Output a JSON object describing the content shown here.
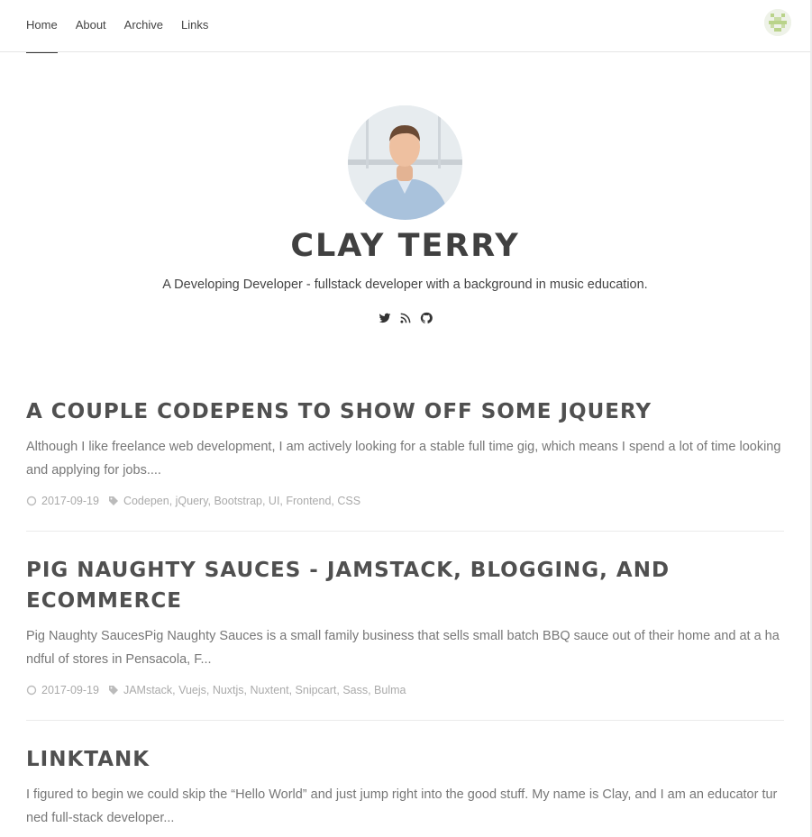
{
  "nav": {
    "items": [
      {
        "label": "Home",
        "active": true
      },
      {
        "label": "About",
        "active": false
      },
      {
        "label": "Archive",
        "active": false
      },
      {
        "label": "Links",
        "active": false
      }
    ],
    "avatar_icon": "user-identicon"
  },
  "hero": {
    "name": "CLAY TERRY",
    "bio": "A Developing Developer - fullstack developer with a background in music education.",
    "social": [
      "twitter-icon",
      "rss-icon",
      "github-icon"
    ]
  },
  "posts": [
    {
      "title": "A COUPLE CODEPENS TO SHOW OFF SOME JQUERY",
      "excerpt": "Although I like freelance web development, I am actively looking for a stable full time gig, which means I spend a lot of time looking and applying for jobs....",
      "date": "2017-09-19",
      "tags": "Codepen, jQuery, Bootstrap, UI, Frontend, CSS"
    },
    {
      "title": "PIG NAUGHTY SAUCES - JAMSTACK, BLOGGING, AND ECOMMERCE",
      "excerpt": "Pig Naughty SaucesPig Naughty Sauces is a small family business that sells small batch BBQ sauce out of their home and at a handful of stores in Pensacola, F...",
      "date": "2017-09-19",
      "tags": "JAMstack, Vuejs, Nuxtjs, Nuxtent, Snipcart, Sass, Bulma"
    },
    {
      "title": "LINKTANK",
      "excerpt": "I figured to begin we could skip the “Hello World” and just jump right into the good stuff. My name is Clay, and I am an educator turned full-stack developer..."
    }
  ],
  "colors": {
    "accent": "#333333",
    "title": "#505050",
    "meta": "#aaaaaa"
  }
}
